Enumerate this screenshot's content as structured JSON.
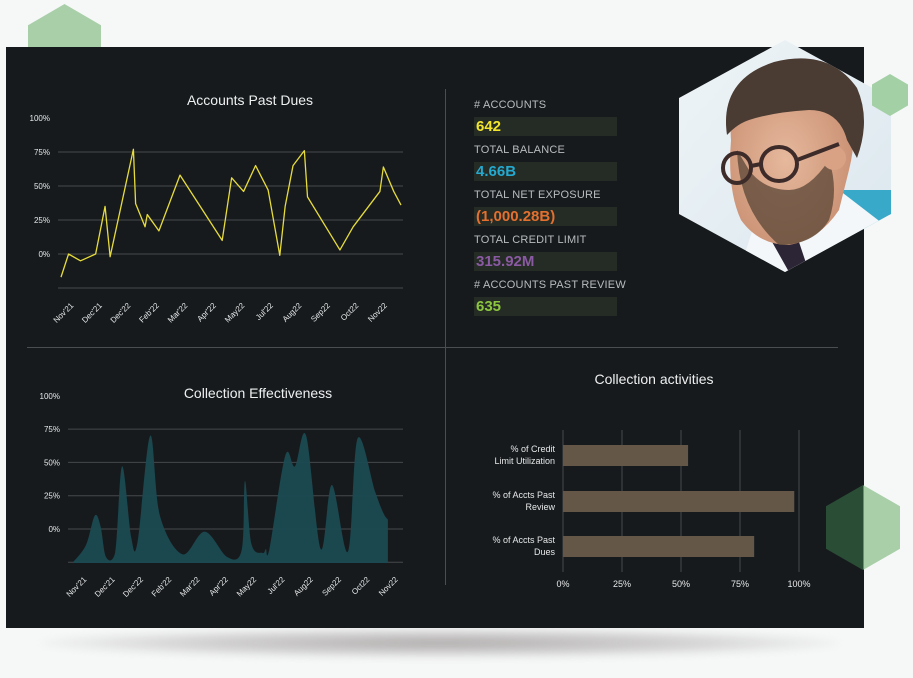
{
  "colors": {
    "panel_bg": "#171a1d",
    "line_series": "#e6dc3c",
    "area_series": "#1b4a52",
    "bar_fill": "#655748",
    "accent_green_light": "#a9cfa9",
    "accent_green_dark": "#2a4d36"
  },
  "kpis": [
    {
      "label": "# ACCOUNTS",
      "value": "642",
      "color": "#f2e52c"
    },
    {
      "label": "TOTAL BALANCE",
      "value": "4.66B",
      "color": "#24a9cf"
    },
    {
      "label": "TOTAL NET EXPOSURE",
      "value": "(1,000.28B)",
      "color": "#e3702e"
    },
    {
      "label": "TOTAL CREDIT LIMIT",
      "value": "315.92M",
      "color": "#8a5aa3"
    },
    {
      "label": "# ACCOUNTS PAST REVIEW",
      "value": "635",
      "color": "#8cc63f"
    }
  ],
  "photo": {
    "subject": "man-with-glasses-portrait"
  },
  "chart_data": [
    {
      "type": "line",
      "title": "Accounts Past Dues",
      "xlabel": "",
      "ylabel": "",
      "ylim": [
        -25,
        100
      ],
      "yticks": [
        "100%",
        "75%",
        "50%",
        "25%",
        "0%"
      ],
      "ytick_values": [
        100,
        75,
        50,
        25,
        0
      ],
      "gridlines": [
        75,
        50,
        25,
        0,
        -25
      ],
      "grid": true,
      "xtick_labels": [
        "Nov'21",
        "Dec'21",
        "Dec'22",
        "Feb'22",
        "Mar'22",
        "Apr'22",
        "May22",
        "Jul'22",
        "Aug22",
        "Sep22",
        "Oct22",
        "Nov22"
      ],
      "x": [
        0,
        2.4,
        6.2,
        11,
        14,
        15.6,
        23,
        23.7,
        26.7,
        27.4,
        31.1,
        37.8,
        51.2,
        54.2,
        58,
        61.8,
        65.8,
        69.5,
        71.2,
        73.7,
        77.3,
        78.3,
        88.6,
        92.8,
        101.3,
        102.4,
        105.7,
        108
      ],
      "values": [
        -17,
        0,
        -5,
        0,
        35,
        -2,
        77,
        37,
        20,
        29,
        17,
        58,
        10,
        56,
        46,
        65,
        47,
        -1,
        35,
        65,
        76,
        42,
        3,
        20,
        46,
        64,
        46,
        36
      ],
      "series": [
        {
          "name": "Accounts Past Dues",
          "color": "#e6dc3c"
        }
      ]
    },
    {
      "type": "area",
      "title": "Collection Effectiveness",
      "xlabel": "",
      "ylabel": "",
      "ylim": [
        -25,
        100
      ],
      "yticks": [
        "100%",
        "75%",
        "50%",
        "25%",
        "0%"
      ],
      "ytick_values": [
        100,
        75,
        50,
        25,
        0
      ],
      "gridlines": [
        75,
        50,
        25,
        0,
        -25
      ],
      "grid": true,
      "xtick_labels": [
        "Nov'21",
        "Dec'21",
        "Dec'22",
        "Feb'22",
        "Mar'22",
        "Apr'22",
        "May22",
        "Jul'22",
        "Aug22",
        "Sep22",
        "Oct22",
        "Nov22"
      ],
      "x": [
        0,
        4.3,
        7.2,
        9.1,
        10.9,
        13.9,
        16.2,
        19.2,
        21.3,
        25.5,
        28.7,
        36.1,
        43.5,
        50.9,
        55.7,
        56.8,
        58.9,
        62.6,
        63.7,
        64.8,
        70.1,
        73.3,
        77,
        81.8,
        85.5,
        90.8,
        94,
        99.8,
        102.5,
        104
      ],
      "values": [
        -25,
        -12,
        10,
        2,
        -21,
        -18,
        47,
        -6,
        -10,
        70,
        10,
        -19,
        -2,
        -21,
        -16,
        36,
        -11,
        -18,
        -15,
        -16,
        55,
        47,
        70,
        -15,
        33,
        -17,
        68,
        28,
        12,
        7
      ],
      "series": [
        {
          "name": "Collection Effectiveness",
          "color": "#1b4a52"
        }
      ]
    },
    {
      "type": "bar",
      "orientation": "horizontal",
      "title": "Collection activities",
      "categories": [
        [
          "% of Credit",
          "Limit Utilization"
        ],
        [
          "% of Accts Past",
          "Review"
        ],
        [
          "% of Accts Past",
          "Dues"
        ]
      ],
      "values": [
        53,
        98,
        81
      ],
      "xlim": [
        0,
        100
      ],
      "xticks": [
        "0%",
        "25%",
        "50%",
        "75%",
        "100%"
      ],
      "xtick_values": [
        0,
        25,
        50,
        75,
        100
      ],
      "grid": true,
      "series": [
        {
          "name": "Collection activities",
          "color": "#655748"
        }
      ]
    }
  ]
}
